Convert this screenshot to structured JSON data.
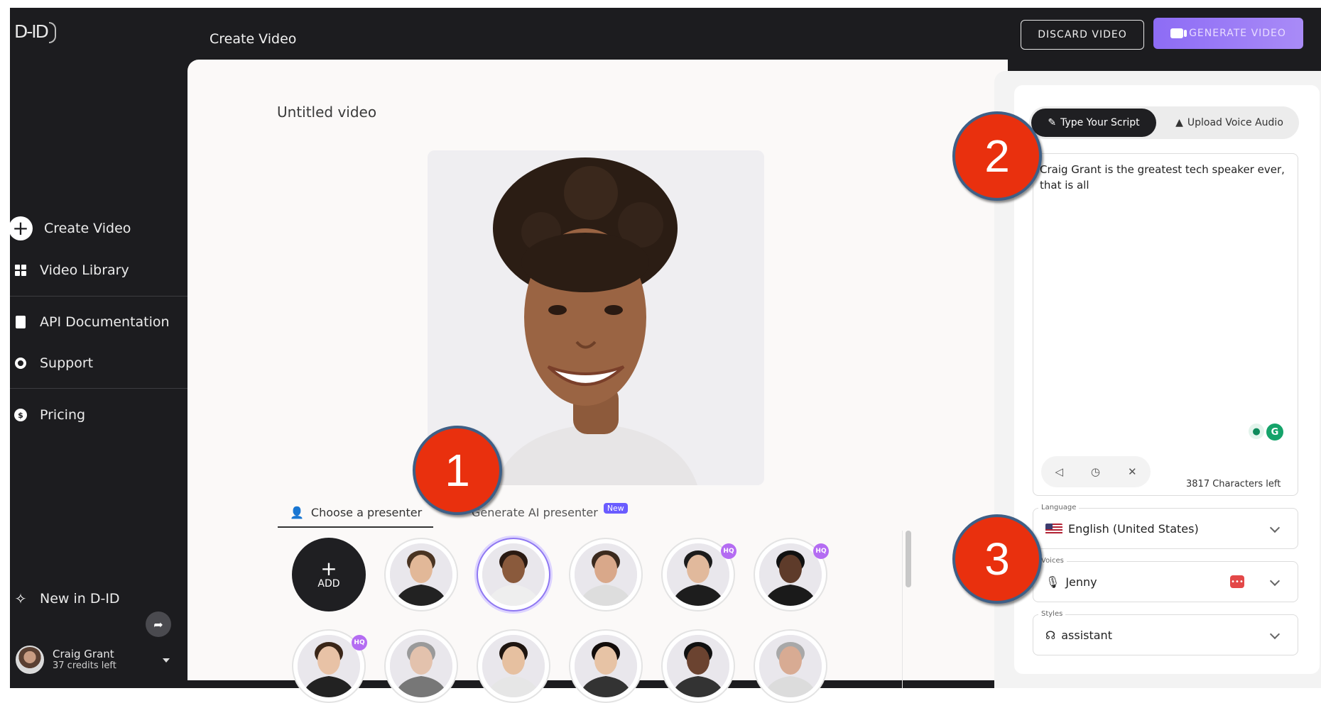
{
  "app": {
    "logo_text": "D-ID"
  },
  "header": {
    "title": "Create Video",
    "discard_label": "DISCARD VIDEO",
    "generate_label": "GENERATE VIDEO"
  },
  "sidebar": {
    "items": [
      {
        "label": "Create Video",
        "icon": "plus-circle-icon"
      },
      {
        "label": "Video Library",
        "icon": "grid-icon"
      },
      {
        "label": "API Documentation",
        "icon": "document-icon"
      },
      {
        "label": "Support",
        "icon": "lifebuoy-icon"
      },
      {
        "label": "Pricing",
        "icon": "coin-icon"
      }
    ],
    "whats_new": "New in D-ID",
    "user": {
      "name": "Craig Grant",
      "credits": "37 credits left"
    }
  },
  "main": {
    "video_title": "Untitled video",
    "tabs": [
      {
        "label": "Choose a presenter"
      },
      {
        "label": "Generate AI presenter",
        "badge": "New"
      }
    ],
    "add_label": "ADD",
    "presenters_row1": [
      {
        "hq": false,
        "selected": false,
        "skin": "#e2b898",
        "hair": "#4a3422",
        "outfit": "#222"
      },
      {
        "hq": false,
        "selected": true,
        "skin": "#8a5a3c",
        "hair": "#2a1a12",
        "outfit": "#eee"
      },
      {
        "hq": false,
        "selected": false,
        "skin": "#d9a88a",
        "hair": "#3b2a1e",
        "outfit": "#ddd"
      },
      {
        "hq": true,
        "selected": false,
        "skin": "#e1b99c",
        "hair": "#1c1c1c",
        "outfit": "#1d1d1d"
      },
      {
        "hq": true,
        "selected": false,
        "skin": "#5e3b2a",
        "hair": "#111",
        "outfit": "#1a1a1a"
      }
    ],
    "presenters_row2": [
      {
        "hq": true,
        "skin": "#e8c2a6",
        "hair": "#3a2618",
        "outfit": "#222"
      },
      {
        "hq": false,
        "skin": "#e3c2ad",
        "hair": "#9a9a9a",
        "outfit": "#777"
      },
      {
        "hq": false,
        "skin": "#e6c0a0",
        "hair": "#1e1510",
        "outfit": "#e6e6e6"
      },
      {
        "hq": false,
        "skin": "#e7c3a5",
        "hair": "#120c0a",
        "outfit": "#333"
      },
      {
        "hq": false,
        "skin": "#6b4330",
        "hair": "#111",
        "outfit": "#333"
      },
      {
        "hq": false,
        "skin": "#d8ab93",
        "hair": "#a8a8a8",
        "outfit": "#dcdcdc"
      }
    ],
    "hq_label": "HQ"
  },
  "script_panel": {
    "tab_type": "Type Your Script",
    "tab_upload": "Upload Voice Audio",
    "script_text": "Craig Grant is the greatest tech speaker ever, that is all",
    "chars_left": "3817 Characters left",
    "language_label": "Language",
    "language_value": "English (United States)",
    "voices_label": "Voices",
    "voice_value": "Jenny",
    "styles_label": "Styles",
    "style_value": "assistant"
  },
  "callouts": [
    "1",
    "2",
    "3"
  ],
  "colors": {
    "accent": "#8d6cf5",
    "callout": "#e9300e",
    "callout_border": "#3e5f86"
  }
}
